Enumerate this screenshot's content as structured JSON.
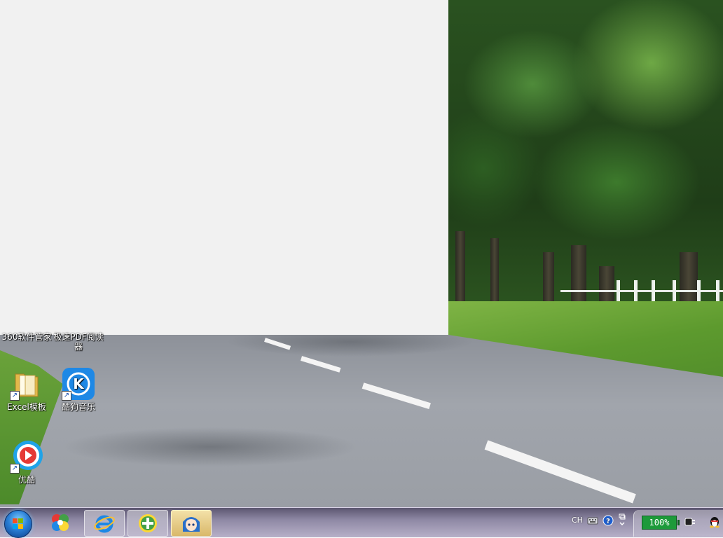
{
  "desktop": {
    "icons": [
      {
        "id": "excel",
        "label": "Excel模板"
      },
      {
        "id": "kugou",
        "label": "酷狗音乐"
      },
      {
        "id": "youku",
        "label": "优酷"
      }
    ],
    "partial_labels": {
      "left": "360软件管家",
      "right_line1": "极速PDF阅读",
      "right_line2": "器"
    }
  },
  "taskbar": {
    "language": "CH",
    "battery_percent": "100%",
    "colors": {
      "battery": "#1d9a3a",
      "start_orb": "#2a7fd6"
    },
    "apps": [
      {
        "id": "app360",
        "icon": "360-icon"
      },
      {
        "id": "ie",
        "icon": "internet-explorer-icon"
      },
      {
        "id": "plus",
        "icon": "green-plus-icon"
      },
      {
        "id": "anime",
        "icon": "anime-girl-icon"
      }
    ]
  }
}
